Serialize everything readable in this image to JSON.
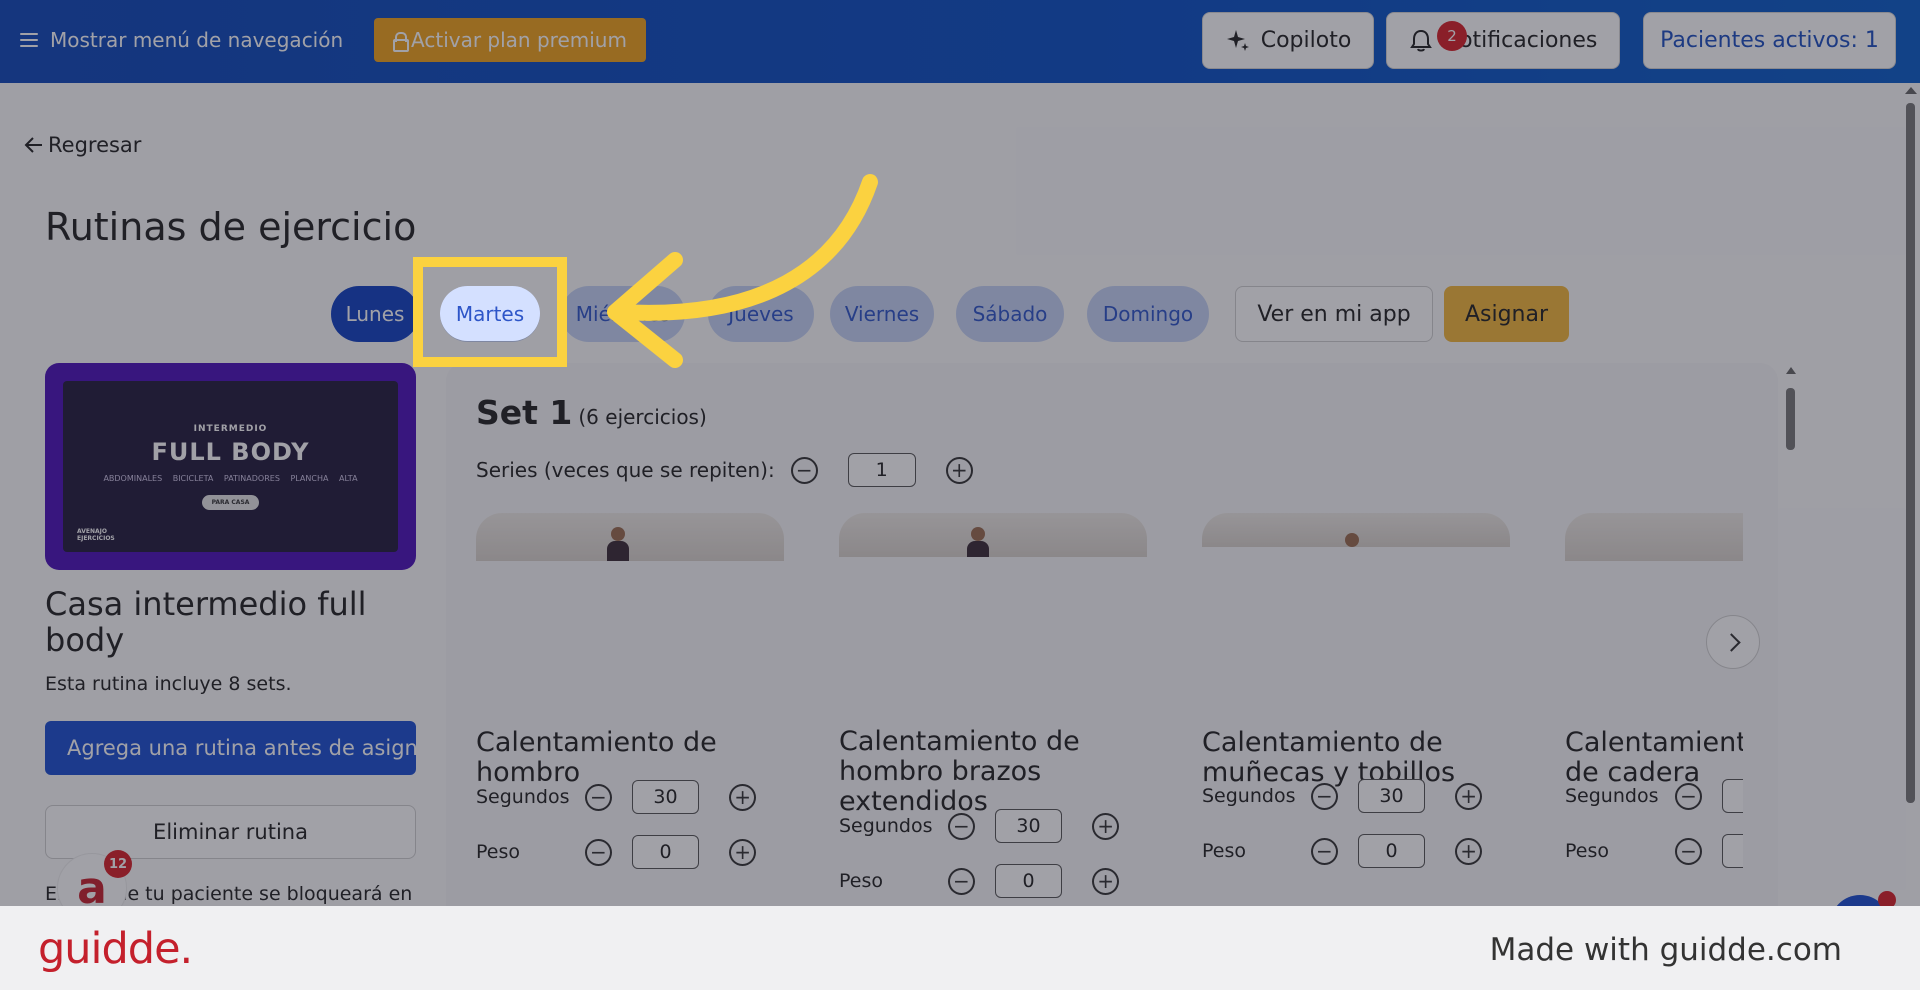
{
  "topbar": {
    "nav_menu_label": "Mostrar menú de navegación",
    "premium_label": "Activar plan premium",
    "copilot_label": "Copiloto",
    "notifications_label": "Notificaciones",
    "notifications_count": "2",
    "patients_label": "Pacientes activos: 1"
  },
  "page": {
    "back_label": "Regresar",
    "title": "Rutinas de ejercicio"
  },
  "days": [
    {
      "label": "Lunes",
      "active": true
    },
    {
      "label": "Martes",
      "active": false
    },
    {
      "label": "Miércoles",
      "active": false
    },
    {
      "label": "Jueves",
      "active": false
    },
    {
      "label": "Viernes",
      "active": false
    },
    {
      "label": "Sábado",
      "active": false
    },
    {
      "label": "Domingo",
      "active": false
    }
  ],
  "actions": {
    "view_app_label": "Ver en mi app",
    "assign_label": "Asignar"
  },
  "routine": {
    "thumb_level": "INTERMEDIO",
    "thumb_title": "FULL BODY",
    "thumb_tags": "ABDOMINALES BICICLETA   PATINADORES   PLANCHA ALTA",
    "thumb_pill": "PARA CASA",
    "thumb_corner": "AVENAJO EJERCICIOS",
    "name": "Casa intermedio full body",
    "description": "Esta rutina incluye 8 sets.",
    "add_routine_label": "Agrega una rutina antes de asignar",
    "delete_label": "Eliminar rutina",
    "block_text": "El día que tu paciente se bloqueará en"
  },
  "set": {
    "title": "Set 1",
    "count": "(6 ejercicios)",
    "series_label": "Series (veces que se repiten):",
    "series_value": "1",
    "exercises": [
      {
        "name": "Calentamiento de hombro",
        "seconds_label": "Segundos",
        "seconds": "30",
        "weight_label": "Peso",
        "weight": "0"
      },
      {
        "name": "Calentamiento de hombro brazos extendidos",
        "seconds_label": "Segundos",
        "seconds": "30",
        "weight_label": "Peso",
        "weight": "0"
      },
      {
        "name": "Calentamiento de muñecas y tobillos",
        "seconds_label": "Segundos",
        "seconds": "30",
        "weight_label": "Peso",
        "weight": "0"
      },
      {
        "name": "Calentamiento de cadera",
        "seconds_label": "Segundos",
        "seconds": "",
        "weight_label": "Peso",
        "weight": ""
      }
    ]
  },
  "widget": {
    "logo_letter": "a",
    "logo_badge": "12"
  },
  "footer": {
    "brand": "guidde.",
    "made_with": "Made with guidde.com"
  },
  "colors": {
    "topbar": "#0e47b8",
    "accent": "#1b4fd0",
    "premium": "#f0a21b",
    "assign": "#f3b73a",
    "highlight": "#fbd240",
    "brand": "#c4202c"
  }
}
